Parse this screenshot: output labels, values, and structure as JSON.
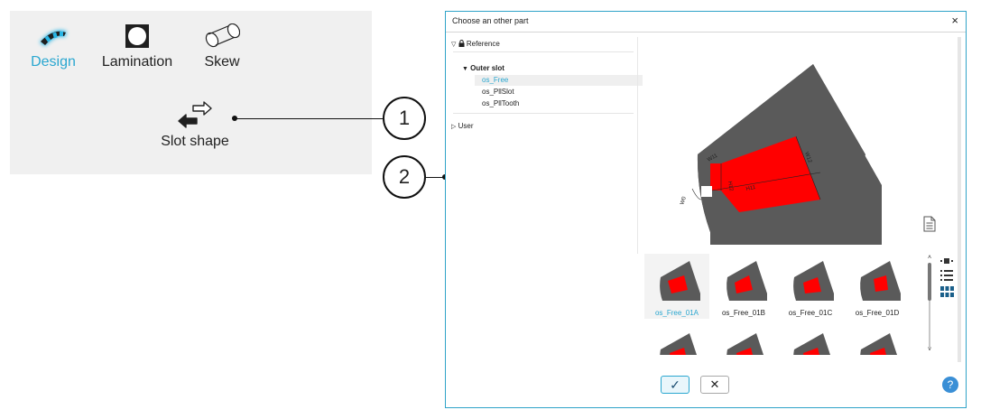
{
  "ribbon": {
    "buttons": [
      {
        "label": "Design",
        "icon": "design-icon",
        "active": true
      },
      {
        "label": "Lamination",
        "icon": "lamination-icon"
      },
      {
        "label": "Skew",
        "icon": "skew-icon"
      }
    ],
    "slot_shape": {
      "label": "Slot shape",
      "icon": "swap-arrows-icon"
    }
  },
  "callouts": [
    "1",
    "2"
  ],
  "dialog": {
    "title": "Choose an other part",
    "close_glyph": "×",
    "tree": {
      "reference_label": "Reference",
      "group_label": "Outer slot",
      "items": [
        "os_Free",
        "os_PllSlot",
        "os_PllTooth"
      ],
      "selected_index": 0,
      "user_label": "User"
    },
    "preview_labels": {
      "a": "W11",
      "b": "H11",
      "c": "W12",
      "d": "H12",
      "e": "W0"
    },
    "thumbnails": [
      "os_Free_01A",
      "os_Free_01B",
      "os_Free_01C",
      "os_Free_01D"
    ],
    "selected_thumbnail": 0,
    "view_icons": [
      "thumbnail-small-icon",
      "list-view-icon",
      "grid-view-icon"
    ],
    "ok_glyph": "✓",
    "cancel_glyph": "✕",
    "help_glyph": "?"
  },
  "colors": {
    "accent": "#2aa7d0",
    "slot_red": "#ff0000",
    "lamination_grey": "#5a5a5a"
  }
}
